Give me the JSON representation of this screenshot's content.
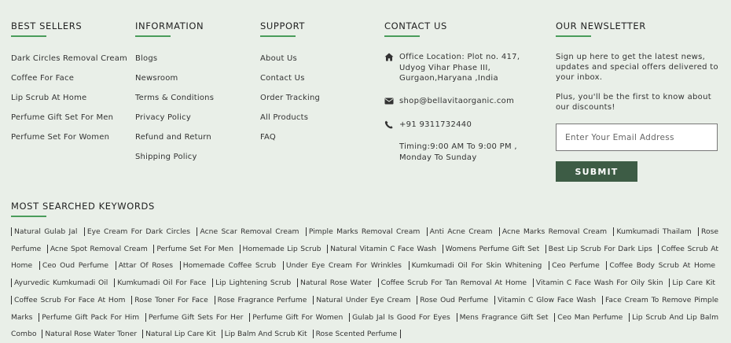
{
  "best_sellers": {
    "heading": "BEST SELLERS",
    "items": [
      "Dark Circles Removal Cream",
      "Coffee For Face",
      "Lip Scrub At Home",
      "Perfume Gift Set For Men",
      "Perfume Set For Women"
    ]
  },
  "information": {
    "heading": "INFORMATION",
    "items": [
      "Blogs",
      "Newsroom",
      "Terms & Conditions",
      "Privacy Policy",
      "Refund and Return",
      "Shipping Policy"
    ]
  },
  "support": {
    "heading": "SUPPORT",
    "items": [
      "About Us",
      "Contact Us",
      "Order Tracking",
      "All Products",
      "FAQ"
    ]
  },
  "contact": {
    "heading": "CONTACT US",
    "address": "Office Location: Plot no. 417,\nUdyog Vihar Phase III,\nGurgaon,Haryana ,India",
    "email": "shop@bellavitaorganic.com",
    "phone": "+91 9311732440",
    "timing": "Timing:9:00 AM To 9:00 PM ,\nMonday To Sunday"
  },
  "newsletter": {
    "heading": "OUR NEWSLETTER",
    "text1": "Sign up here to get the latest news, updates and special offers delivered to your inbox.",
    "text2": "Plus, you'll be the first to know about our discounts!",
    "placeholder": "Enter Your Email Address",
    "submit_label": "SUBMIT"
  },
  "keywords": {
    "heading": "MOST SEARCHED KEYWORDS",
    "items": [
      "Natural Gulab Jal",
      "Eye Cream For Dark Circles",
      "Acne Scar Removal Cream",
      "Pimple Marks Removal Cream",
      "Anti Acne Cream",
      "Acne Marks Removal Cream",
      "Kumkumadi Thailam",
      "Rose Perfume",
      "Acne Spot Removal Cream",
      "Perfume Set For Men",
      "Homemade Lip Scrub",
      "Natural Vitamin C Face Wash",
      "Womens Perfume Gift Set",
      "Best Lip Scrub For Dark Lips",
      "Coffee Scrub At Home",
      "Ceo Oud Perfume",
      "Attar Of Roses",
      "Homemade Coffee Scrub",
      "Under Eye Cream For Wrinkles",
      "Kumkumadi Oil For Skin Whitening",
      "Ceo Perfume",
      "Coffee Body Scrub At Home",
      "Ayurvedic Kumkumadi Oil",
      "Kumkumadi Oil For Face",
      "Lip Lightening Scrub",
      "Natural Rose Water",
      "Coffee Scrub For Tan Removal At Home",
      "Vitamin C Face Wash For Oily Skin",
      "Lip Care Kit",
      "Coffee Scrub For Face At Hom",
      "Rose Toner For Face",
      "Rose Fragrance Perfume",
      "Natural Under Eye Cream",
      "Rose Oud Perfume",
      "Vitamin C Glow Face Wash",
      "Face Cream To Remove Pimple Marks",
      "Perfume Gift Pack For Him",
      "Perfume Gift Sets For Her",
      "Perfume Gift For Women",
      "Gulab Jal Is Good For Eyes",
      "Mens Fragrance Gift Set",
      "Ceo Man Perfume",
      "Lip Scrub And Lip Balm Combo",
      "Natural Rose Water Toner",
      "Natural Lip Care Kit",
      "Lip Balm And Scrub Kit",
      "Rose Scented Perfume"
    ]
  },
  "icons": {
    "address": "home-icon",
    "email": "envelope-icon",
    "phone": "phone-icon"
  },
  "colors": {
    "background": "#e9efe8",
    "accent_underline": "#4a9c5b",
    "button": "#3d5c45"
  }
}
